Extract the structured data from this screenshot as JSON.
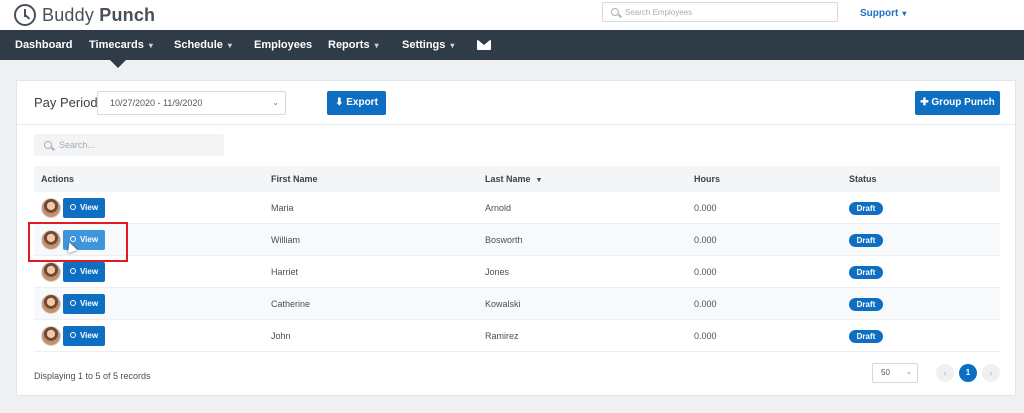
{
  "brand": {
    "name_light": "Buddy ",
    "name_bold": "Punch"
  },
  "top_search": {
    "placeholder": "Search Employees"
  },
  "support": {
    "label": "Support",
    "chevron": "▾"
  },
  "nav": {
    "chevron": "▾",
    "items": [
      {
        "label": "Dashboard"
      },
      {
        "label": "Timecards"
      },
      {
        "label": "Schedule"
      },
      {
        "label": "Employees"
      },
      {
        "label": "Reports"
      },
      {
        "label": "Settings"
      }
    ],
    "active": "Timecards"
  },
  "pay_period": {
    "label": "Pay Period",
    "value": "10/27/2020 - 11/9/2020",
    "chevron": "⌄"
  },
  "buttons": {
    "export": "⬇ Export",
    "group_punch": "✚ Group Punch"
  },
  "list_search": {
    "placeholder": "Search..."
  },
  "table": {
    "columns": {
      "actions": "Actions",
      "first_name": "First Name",
      "last_name": "Last Name",
      "last_name_sort": "▼",
      "hours": "Hours",
      "status": "Status"
    },
    "view_label": "View",
    "rows": [
      {
        "first": "Maria",
        "last": "Arnold",
        "hours": "0.000",
        "status": "Draft"
      },
      {
        "first": "William",
        "last": "Bosworth",
        "hours": "0.000",
        "status": "Draft"
      },
      {
        "first": "Harriet",
        "last": "Jones",
        "hours": "0.000",
        "status": "Draft"
      },
      {
        "first": "Catherine",
        "last": "Kowalski",
        "hours": "0.000",
        "status": "Draft"
      },
      {
        "first": "John",
        "last": "Ramirez",
        "hours": "0.000",
        "status": "Draft"
      }
    ]
  },
  "footer": {
    "records": "Displaying 1 to 5 of 5 records",
    "page_size": "50",
    "page_size_chevron": "⌄",
    "prev": "‹",
    "current_page": "1",
    "next": "›"
  },
  "colors": {
    "primary": "#0e6fc2",
    "navbar": "#303b48",
    "highlight": "#e01b24"
  }
}
